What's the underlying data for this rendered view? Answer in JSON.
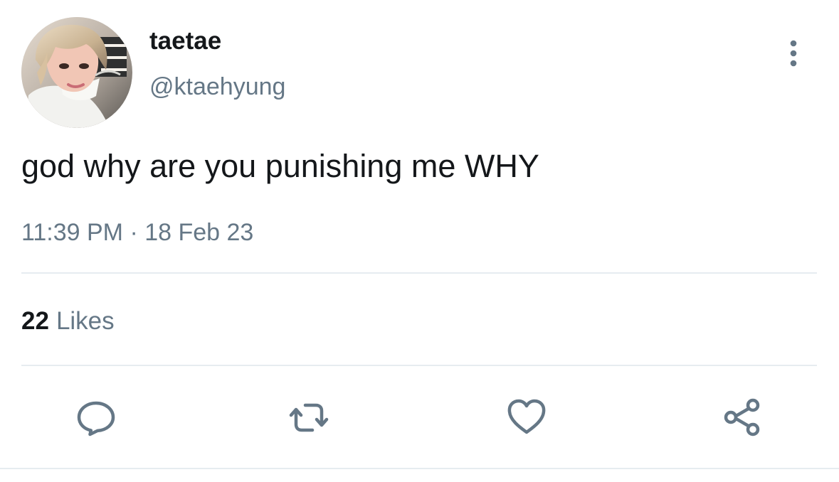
{
  "tweet": {
    "author": {
      "display_name": "taetae",
      "handle": "@ktaehyung"
    },
    "text": "god why are you punishing me WHY",
    "timestamp": "11:39 PM · 18 Feb 23",
    "likes": {
      "count": "22",
      "label": "Likes"
    }
  },
  "actions": {
    "reply_icon": "comment-icon",
    "retweet_icon": "retweet-icon",
    "like_icon": "heart-icon",
    "share_icon": "share-icon",
    "more_icon": "vertical-dots-icon"
  },
  "colors": {
    "primary_text": "#14171a",
    "secondary_text": "#657786",
    "divider": "#e6ecf0",
    "icon": "#657786",
    "background": "#ffffff"
  }
}
